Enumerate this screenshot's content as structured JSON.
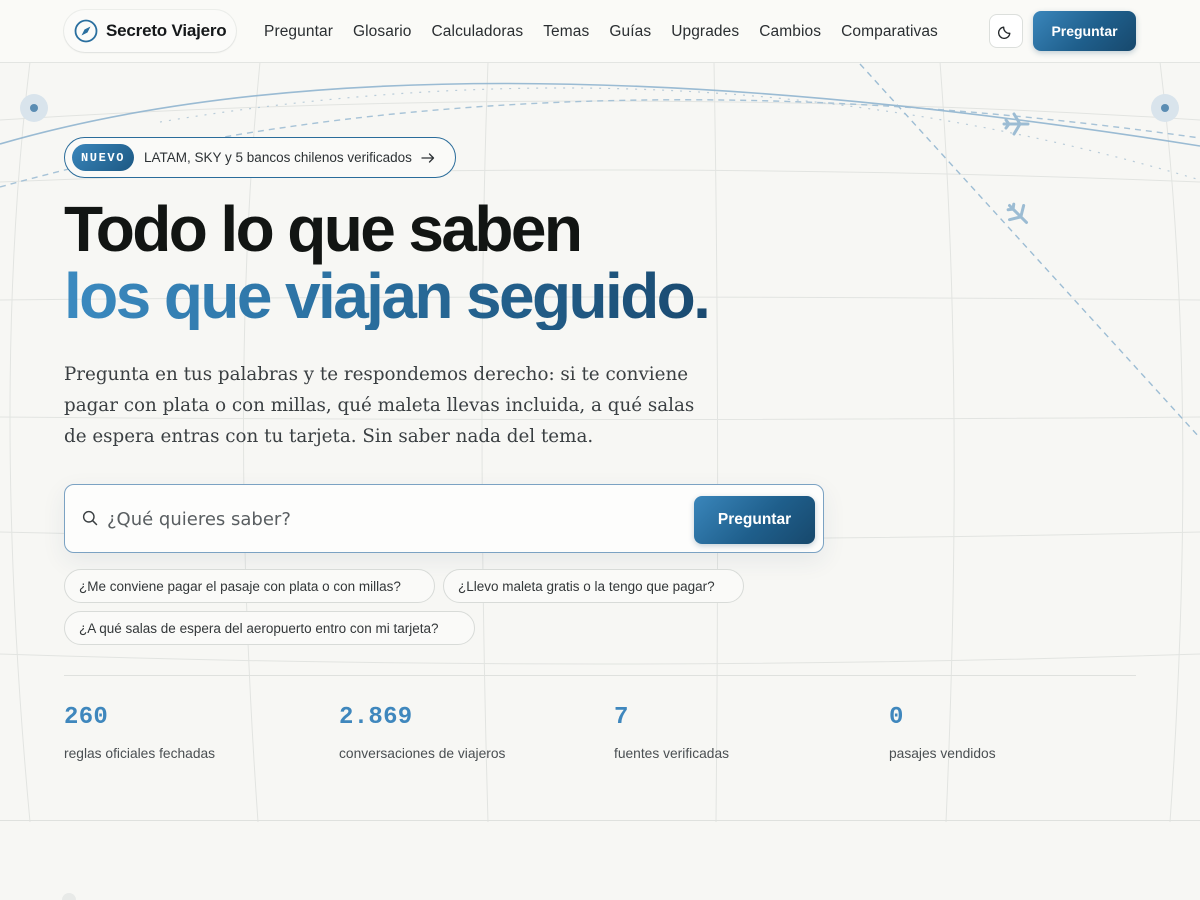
{
  "header": {
    "brand": "Secreto Viajero",
    "nav": [
      "Preguntar",
      "Glosario",
      "Calculadoras",
      "Temas",
      "Guías",
      "Upgrades",
      "Cambios",
      "Comparativas"
    ],
    "cta": "Preguntar",
    "theme_icon": "moon-icon"
  },
  "hero": {
    "badge_tag": "NUEVO",
    "badge_text": "LATAM, SKY y 5 bancos chilenos verificados",
    "title_line1": "Todo lo que saben",
    "title_line2": "los que viajan seguido.",
    "lead": "Pregunta en tus palabras y te respondemos derecho: si te conviene pagar con plata o con millas, qué maleta llevas incluida, a qué salas de espera entras con tu tarjeta. Sin saber nada del tema."
  },
  "search": {
    "placeholder": "¿Qué quieres saber?",
    "value": "",
    "button": "Preguntar"
  },
  "suggestions": [
    "¿Me conviene pagar el pasaje con plata o con millas?",
    "¿Llevo maleta gratis o la tengo que pagar?",
    "¿A qué salas de espera del aeropuerto entro con mi tarjeta?"
  ],
  "stats": [
    {
      "value": "260",
      "label": "reglas oficiales fechadas"
    },
    {
      "value": "2.869",
      "label": "conversaciones de viajeros"
    },
    {
      "value": "7",
      "label": "fuentes verificadas"
    },
    {
      "value": "0",
      "label": "pasajes vendidos"
    }
  ],
  "colors": {
    "accent": "#2a6f9f",
    "accent_light": "#3f87bd",
    "accent_dark": "#17486c",
    "text": "#121513",
    "background": "#f7f7f4"
  }
}
